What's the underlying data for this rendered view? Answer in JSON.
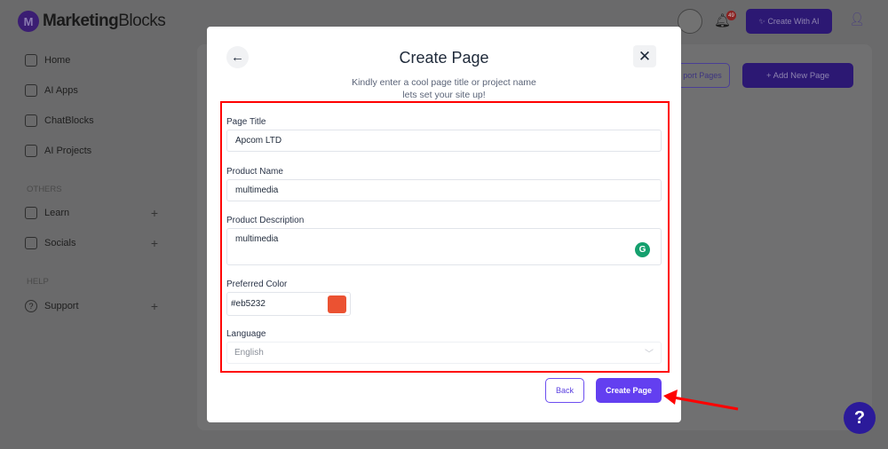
{
  "app": {
    "brand_bold": "Marketing",
    "brand_light": "Blocks"
  },
  "sidebar": {
    "items": [
      {
        "label": "Home",
        "icon": "home-icon"
      },
      {
        "label": "AI Apps",
        "icon": "grid-icon"
      },
      {
        "label": "ChatBlocks",
        "icon": "chat-icon"
      },
      {
        "label": "AI Projects",
        "icon": "folder-icon"
      }
    ],
    "others_title": "OTHERS",
    "others": [
      {
        "label": "Learn",
        "icon": "book-icon"
      },
      {
        "label": "Socials",
        "icon": "users-icon"
      }
    ],
    "help_title": "HELP",
    "help": [
      {
        "label": "Support",
        "icon": "question-circle-icon"
      }
    ]
  },
  "header": {
    "notification_count": "49",
    "create_ai_label": "Create With AI"
  },
  "toolbar": {
    "import_label": "port Pages",
    "add_label": "+ Add New Page"
  },
  "modal": {
    "title": "Create Page",
    "subtitle_line1": "Kindly enter a cool page title or project name",
    "subtitle_line2": "lets set your site up!",
    "fields": {
      "page_title": {
        "label": "Page Title",
        "value": "Apcom LTD"
      },
      "product_name": {
        "label": "Product Name",
        "value": "multimedia"
      },
      "product_description": {
        "label": "Product Description",
        "value": "multimedia"
      },
      "preferred_color": {
        "label": "Preferred Color",
        "value": "#eb5232"
      },
      "language": {
        "label": "Language",
        "value": "English"
      }
    },
    "back_label": "Back",
    "create_label": "Create Page"
  },
  "colors": {
    "accent": "#633ff0",
    "highlight": "#ff0000",
    "swatch": "#eb5232"
  },
  "help_button": "?"
}
